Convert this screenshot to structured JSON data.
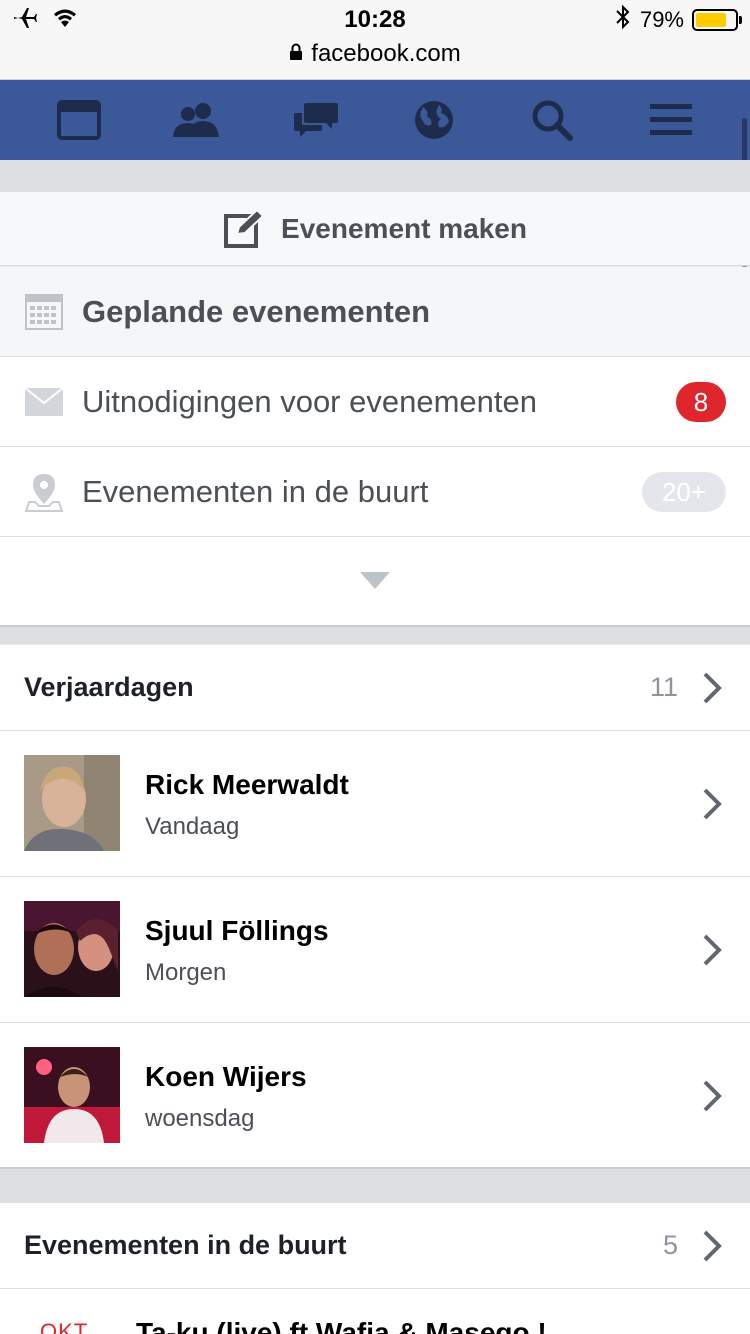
{
  "status": {
    "time": "10:28",
    "battery": "79%",
    "battery_level": 0.79,
    "url": "facebook.com"
  },
  "nav": [
    "feed-icon",
    "friends-icon",
    "messages-icon",
    "notifications-globe-icon",
    "search-icon",
    "menu-icon"
  ],
  "create_event": {
    "label": "Evenement maken"
  },
  "menu": {
    "planned": {
      "label": "Geplande evenementen"
    },
    "invites": {
      "label": "Uitnodigingen voor evenementen",
      "count": "8"
    },
    "nearby": {
      "label": "Evenementen in de buurt",
      "count": "20+"
    }
  },
  "birthdays": {
    "title": "Verjaardagen",
    "count": "11",
    "people": [
      {
        "name": "Rick Meerwaldt",
        "when": "Vandaag"
      },
      {
        "name": "Sjuul Föllings",
        "when": "Morgen"
      },
      {
        "name": "Koen Wijers",
        "when": "woensdag"
      }
    ]
  },
  "nearby_section": {
    "title": "Evenementen in de buurt",
    "count": "5",
    "first_event": {
      "month": "OKT",
      "title": "Ta-ku (live) ft Wafia & Masego !"
    }
  },
  "colors": {
    "brand": "#3b5998",
    "badge_red": "#e0262d",
    "battery": "#ffcc00"
  }
}
